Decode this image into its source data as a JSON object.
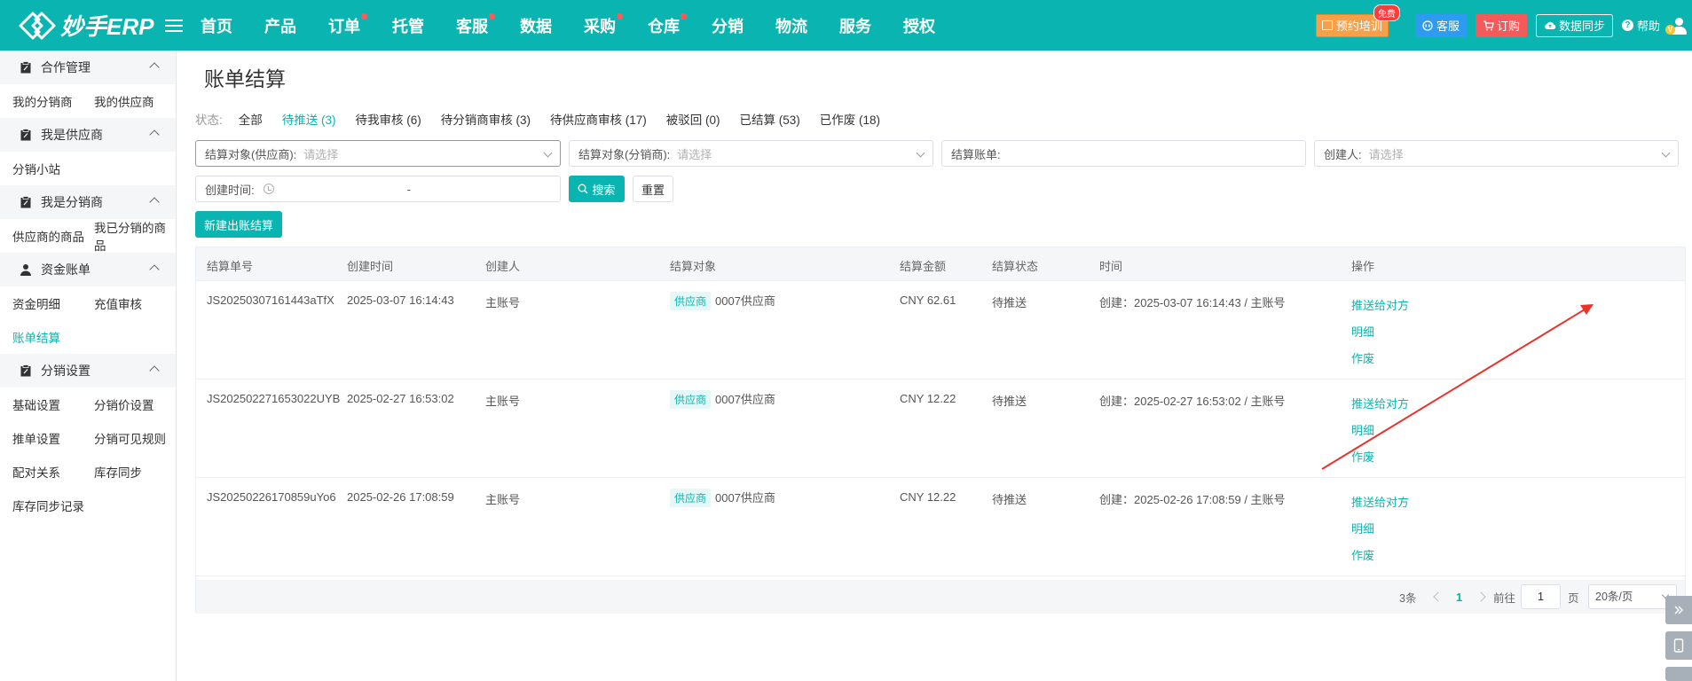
{
  "app": {
    "logo_text": "妙手ERP"
  },
  "nav": [
    {
      "label": "首页",
      "dot": false
    },
    {
      "label": "产品",
      "dot": false
    },
    {
      "label": "订单",
      "dot": true
    },
    {
      "label": "托管",
      "dot": false
    },
    {
      "label": "客服",
      "dot": true
    },
    {
      "label": "数据",
      "dot": false
    },
    {
      "label": "采购",
      "dot": true
    },
    {
      "label": "仓库",
      "dot": true
    },
    {
      "label": "分销",
      "dot": false
    },
    {
      "label": "物流",
      "dot": false
    },
    {
      "label": "服务",
      "dot": false
    },
    {
      "label": "授权",
      "dot": false
    }
  ],
  "top_right": {
    "training": "预约培训",
    "free_tag": "免费",
    "kefu": "客服",
    "order": "订购",
    "sync": "数据同步",
    "help": "帮助",
    "vip": "V"
  },
  "sidebar": [
    {
      "title": "合作管理",
      "items": [
        "我的分销商",
        "我的供应商"
      ]
    },
    {
      "title": "我是供应商",
      "items": [
        "分销小站"
      ]
    },
    {
      "title": "我是分销商",
      "items": [
        "供应商的商品",
        "我已分销的商品"
      ]
    },
    {
      "title": "资金账单",
      "items": [
        "资金明细",
        "充值审核",
        "账单结算"
      ]
    },
    {
      "title": "分销设置",
      "items": [
        "基础设置",
        "分销价设置",
        "推单设置",
        "分销可见规则",
        "配对关系",
        "库存同步",
        "库存同步记录"
      ]
    }
  ],
  "sidebar_active": "账单结算",
  "page": {
    "title": "账单结算"
  },
  "status": {
    "label": "状态:",
    "items": [
      {
        "label": "全部",
        "active": false
      },
      {
        "label": "待推送 (3)",
        "active": true
      },
      {
        "label": "待我审核 (6)",
        "active": false
      },
      {
        "label": "待分销商审核 (3)",
        "active": false
      },
      {
        "label": "待供应商审核 (17)",
        "active": false
      },
      {
        "label": "被驳回 (0)",
        "active": false
      },
      {
        "label": "已结算 (53)",
        "active": false
      },
      {
        "label": "已作废 (18)",
        "active": false
      }
    ]
  },
  "filters": {
    "supplier_label": "结算对象(供应商):",
    "supplier_placeholder": "请选择",
    "distributor_label": "结算对象(分销商):",
    "distributor_placeholder": "请选择",
    "bill_label": "结算账单:",
    "creator_label": "创建人:",
    "creator_placeholder": "请选择",
    "time_label": "创建时间:",
    "time_sep": "-",
    "search": "搜索",
    "reset": "重置",
    "new_button": "新建出账结算"
  },
  "table": {
    "columns": [
      "结算单号",
      "创建时间",
      "创建人",
      "结算对象",
      "结算金额",
      "结算状态",
      "时间",
      "操作"
    ],
    "rows": [
      {
        "no": "JS20250307161443aTfX",
        "created": "2025-03-07 16:14:43",
        "creator": "主账号",
        "target_tag": "供应商",
        "target": "0007供应商",
        "amount": "CNY 62.61",
        "status": "待推送",
        "time": "创建：2025-03-07 16:14:43 / 主账号",
        "ops": [
          "推送给对方",
          "明细",
          "作废"
        ]
      },
      {
        "no": "JS202502271653022UYB",
        "created": "2025-02-27 16:53:02",
        "creator": "主账号",
        "target_tag": "供应商",
        "target": "0007供应商",
        "amount": "CNY 12.22",
        "status": "待推送",
        "time": "创建：2025-02-27 16:53:02 / 主账号",
        "ops": [
          "推送给对方",
          "明细",
          "作废"
        ]
      },
      {
        "no": "JS20250226170859uYo6",
        "created": "2025-02-26 17:08:59",
        "creator": "主账号",
        "target_tag": "供应商",
        "target": "0007供应商",
        "amount": "CNY 12.22",
        "status": "待推送",
        "time": "创建：2025-02-26 17:08:59 / 主账号",
        "ops": [
          "推送给对方",
          "明细",
          "作废"
        ]
      }
    ]
  },
  "pagination": {
    "total": "3条",
    "current": "1",
    "goto": "前往",
    "goto_value": "1",
    "page_unit": "页",
    "page_size": "20条/页"
  },
  "colors": {
    "brand": "#0ab5b1",
    "annotation_arrow": "#e8322a"
  }
}
